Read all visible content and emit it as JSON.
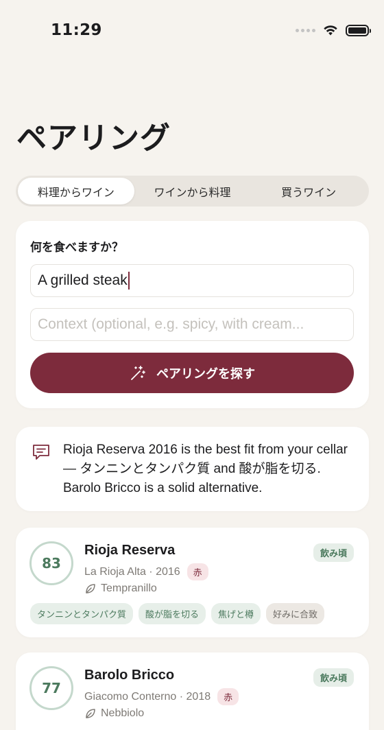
{
  "status_bar": {
    "time": "11:29"
  },
  "page": {
    "title": "ペアリング"
  },
  "tabs": [
    {
      "label": "料理からワイン",
      "active": true
    },
    {
      "label": "ワインから料理",
      "active": false
    },
    {
      "label": "買うワイン",
      "active": false
    }
  ],
  "query": {
    "label": "何を食べますか？",
    "dish_value": "A grilled steak",
    "context_placeholder": "Context (optional, e.g. spicy, with cream...",
    "context_value": "",
    "submit_label": "ペアリングを探す"
  },
  "summary": {
    "text": "Rioja Reserva 2016 is the best fit from your cellar — タンニンとタンパク質 and 酸が脂を切る. Barolo Bricco is a solid alternative."
  },
  "results": [
    {
      "score": "83",
      "name": "Rioja Reserva",
      "producer": "La Rioja Alta",
      "vintage": "2016",
      "color": "赤",
      "grape": "Tempranillo",
      "status": "飲み頃",
      "tags": [
        {
          "label": "タンニンとタンパク質",
          "kind": "match"
        },
        {
          "label": "酸が脂を切る",
          "kind": "match"
        },
        {
          "label": "焦げと樽",
          "kind": "match"
        },
        {
          "label": "好みに合致",
          "kind": "pref"
        }
      ]
    },
    {
      "score": "77",
      "name": "Barolo Bricco",
      "producer": "Giacomo Conterno",
      "vintage": "2018",
      "color": "赤",
      "grape": "Nebbiolo",
      "status": "飲み頃",
      "tags": []
    }
  ],
  "colors": {
    "background": "#f6f3ee",
    "accent": "#7d2b3c",
    "score_green": "#4c7a5e",
    "ring": "#c4d8cc"
  },
  "icons": {
    "wifi": "wifi-icon",
    "battery": "battery-icon",
    "button": "magic-wand-icon",
    "summary": "chat-bubble-icon",
    "grape": "leaf-icon"
  }
}
